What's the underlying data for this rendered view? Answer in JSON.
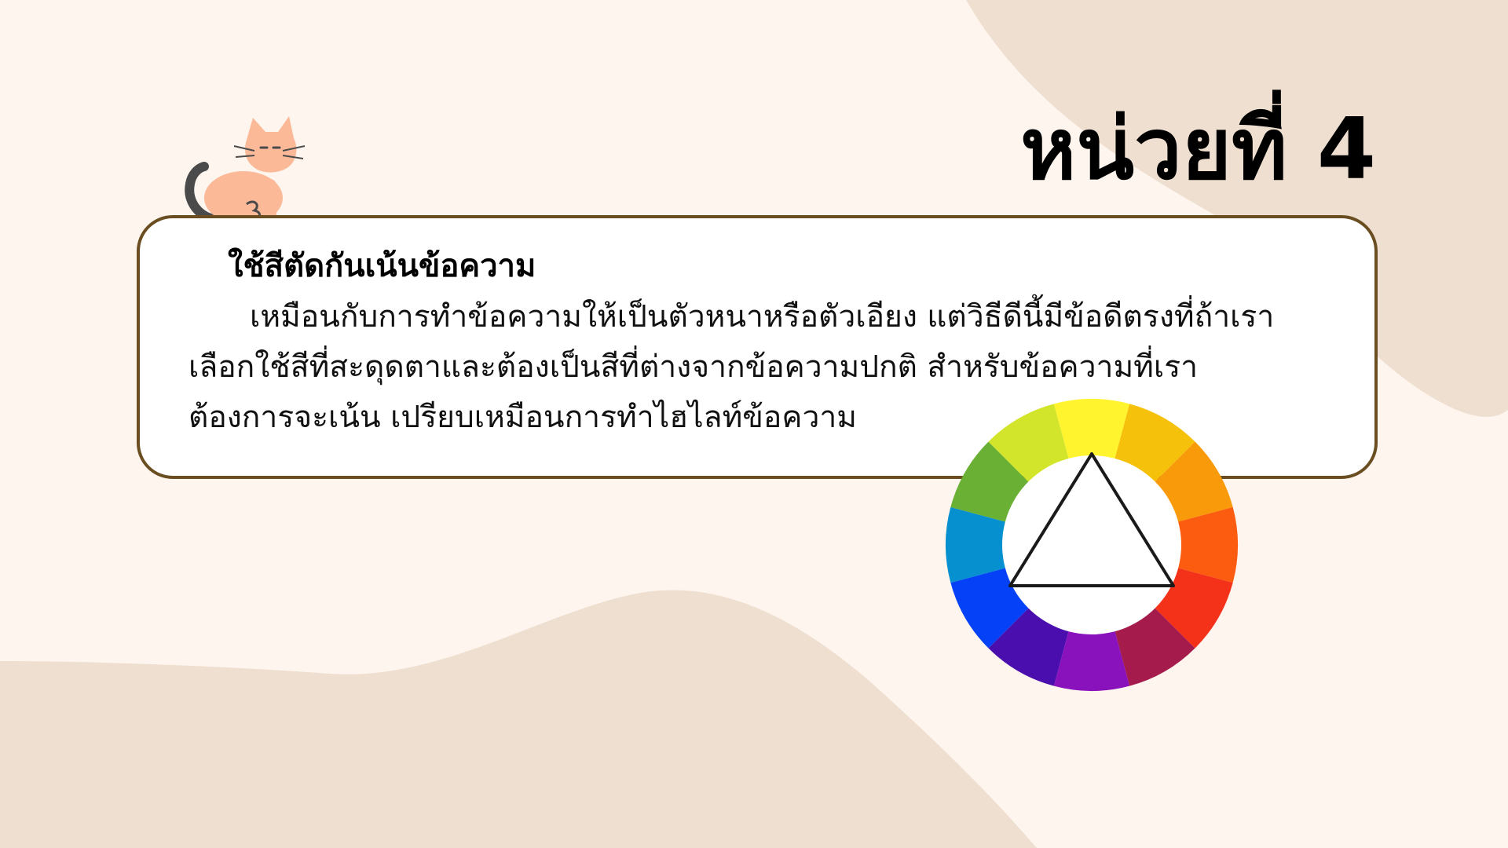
{
  "slide": {
    "title": "หน่วยที่ 4",
    "card": {
      "heading": "ใช้สีตัดกันเน้นข้อความ",
      "lines": [
        "เหมือนกับการทำข้อความให้เป็นตัวหนาหรือตัวเอียง แต่วิธีดีนี้มีข้อดีตรงที่ถ้าเรา",
        "เลือกใช้สีที่สะดุดตาและต้องเป็นสีที่ต่างจากข้อความปกติ สำหรับข้อความที่เรา",
        "ต้องการจะเน้น เปรียบเหมือนการทำไฮไลท์ข้อความ"
      ]
    }
  },
  "icons": {
    "cat": "cat-icon",
    "color_wheel": "color-wheel-icon"
  },
  "colors": {
    "background": "#FEF5EE",
    "blob": "#EFDFD0",
    "card_border": "#6A4E22",
    "cat_body": "#FBB998",
    "cat_tail": "#4A4A4A",
    "wheel_segments": [
      "#FFF42E",
      "#F6C10B",
      "#F89A09",
      "#FB5C0F",
      "#F4321A",
      "#A51B4B",
      "#8A12BC",
      "#4A0EAE",
      "#0441F7",
      "#0690CF",
      "#69B034",
      "#D3E52A"
    ]
  }
}
